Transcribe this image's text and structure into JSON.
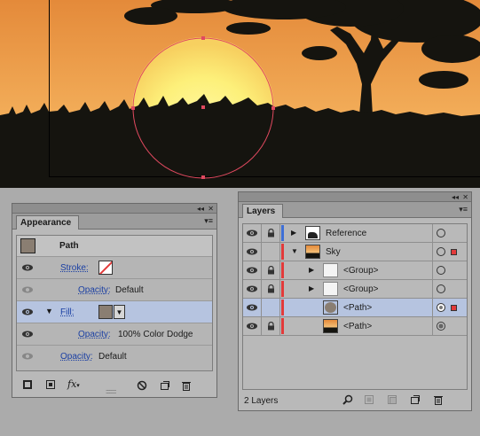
{
  "appearance": {
    "tab_label": "Appearance",
    "header_label": "Path",
    "rows": [
      {
        "label": "Stroke:",
        "kind": "stroke"
      },
      {
        "label": "Opacity:",
        "value": "Default",
        "kind": "sub"
      },
      {
        "label": "Fill:",
        "kind": "fill"
      },
      {
        "label": "Opacity:",
        "value": "100% Color Dodge",
        "kind": "sub"
      },
      {
        "label": "Opacity:",
        "value": "Default",
        "kind": "top"
      }
    ],
    "fill_color": "#8a7e72",
    "fx_label": "fx"
  },
  "layers": {
    "tab_label": "Layers",
    "count_label": "2 Layers",
    "rows": [
      {
        "name": "Reference",
        "indent": 0,
        "expand": "collapsed",
        "color": "#3e6fd6"
      },
      {
        "name": "Sky",
        "indent": 0,
        "expand": "expanded",
        "color": "#e23a3a"
      },
      {
        "name": "<Group>",
        "indent": 1,
        "expand": "collapsed",
        "color": "#e23a3a"
      },
      {
        "name": "<Group>",
        "indent": 1,
        "expand": "collapsed",
        "color": "#e23a3a"
      },
      {
        "name": "<Path>",
        "indent": 1,
        "expand": "none",
        "color": "#e23a3a"
      },
      {
        "name": "<Path>",
        "indent": 1,
        "expand": "none",
        "color": "#e23a3a"
      }
    ]
  },
  "colors": {
    "selection": "#b6c4e0",
    "sky_top": "#e8943e",
    "sky_mid": "#f2b45a",
    "sun": "#fff27a",
    "silhouette": "#15140f",
    "path_outline": "#e0495f"
  }
}
